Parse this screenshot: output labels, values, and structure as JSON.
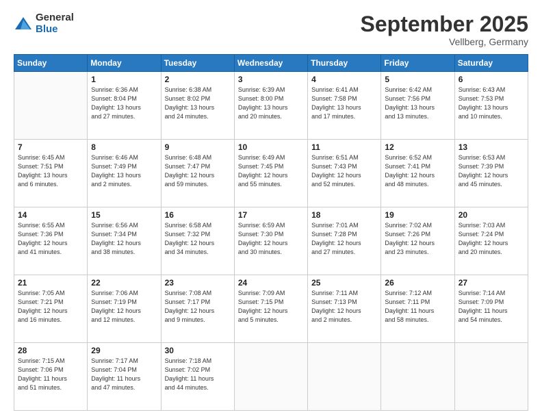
{
  "logo": {
    "general": "General",
    "blue": "Blue"
  },
  "title": "September 2025",
  "location": "Vellberg, Germany",
  "days_header": [
    "Sunday",
    "Monday",
    "Tuesday",
    "Wednesday",
    "Thursday",
    "Friday",
    "Saturday"
  ],
  "weeks": [
    [
      {
        "num": "",
        "info": ""
      },
      {
        "num": "1",
        "info": "Sunrise: 6:36 AM\nSunset: 8:04 PM\nDaylight: 13 hours\nand 27 minutes."
      },
      {
        "num": "2",
        "info": "Sunrise: 6:38 AM\nSunset: 8:02 PM\nDaylight: 13 hours\nand 24 minutes."
      },
      {
        "num": "3",
        "info": "Sunrise: 6:39 AM\nSunset: 8:00 PM\nDaylight: 13 hours\nand 20 minutes."
      },
      {
        "num": "4",
        "info": "Sunrise: 6:41 AM\nSunset: 7:58 PM\nDaylight: 13 hours\nand 17 minutes."
      },
      {
        "num": "5",
        "info": "Sunrise: 6:42 AM\nSunset: 7:56 PM\nDaylight: 13 hours\nand 13 minutes."
      },
      {
        "num": "6",
        "info": "Sunrise: 6:43 AM\nSunset: 7:53 PM\nDaylight: 13 hours\nand 10 minutes."
      }
    ],
    [
      {
        "num": "7",
        "info": "Sunrise: 6:45 AM\nSunset: 7:51 PM\nDaylight: 13 hours\nand 6 minutes."
      },
      {
        "num": "8",
        "info": "Sunrise: 6:46 AM\nSunset: 7:49 PM\nDaylight: 13 hours\nand 2 minutes."
      },
      {
        "num": "9",
        "info": "Sunrise: 6:48 AM\nSunset: 7:47 PM\nDaylight: 12 hours\nand 59 minutes."
      },
      {
        "num": "10",
        "info": "Sunrise: 6:49 AM\nSunset: 7:45 PM\nDaylight: 12 hours\nand 55 minutes."
      },
      {
        "num": "11",
        "info": "Sunrise: 6:51 AM\nSunset: 7:43 PM\nDaylight: 12 hours\nand 52 minutes."
      },
      {
        "num": "12",
        "info": "Sunrise: 6:52 AM\nSunset: 7:41 PM\nDaylight: 12 hours\nand 48 minutes."
      },
      {
        "num": "13",
        "info": "Sunrise: 6:53 AM\nSunset: 7:39 PM\nDaylight: 12 hours\nand 45 minutes."
      }
    ],
    [
      {
        "num": "14",
        "info": "Sunrise: 6:55 AM\nSunset: 7:36 PM\nDaylight: 12 hours\nand 41 minutes."
      },
      {
        "num": "15",
        "info": "Sunrise: 6:56 AM\nSunset: 7:34 PM\nDaylight: 12 hours\nand 38 minutes."
      },
      {
        "num": "16",
        "info": "Sunrise: 6:58 AM\nSunset: 7:32 PM\nDaylight: 12 hours\nand 34 minutes."
      },
      {
        "num": "17",
        "info": "Sunrise: 6:59 AM\nSunset: 7:30 PM\nDaylight: 12 hours\nand 30 minutes."
      },
      {
        "num": "18",
        "info": "Sunrise: 7:01 AM\nSunset: 7:28 PM\nDaylight: 12 hours\nand 27 minutes."
      },
      {
        "num": "19",
        "info": "Sunrise: 7:02 AM\nSunset: 7:26 PM\nDaylight: 12 hours\nand 23 minutes."
      },
      {
        "num": "20",
        "info": "Sunrise: 7:03 AM\nSunset: 7:24 PM\nDaylight: 12 hours\nand 20 minutes."
      }
    ],
    [
      {
        "num": "21",
        "info": "Sunrise: 7:05 AM\nSunset: 7:21 PM\nDaylight: 12 hours\nand 16 minutes."
      },
      {
        "num": "22",
        "info": "Sunrise: 7:06 AM\nSunset: 7:19 PM\nDaylight: 12 hours\nand 12 minutes."
      },
      {
        "num": "23",
        "info": "Sunrise: 7:08 AM\nSunset: 7:17 PM\nDaylight: 12 hours\nand 9 minutes."
      },
      {
        "num": "24",
        "info": "Sunrise: 7:09 AM\nSunset: 7:15 PM\nDaylight: 12 hours\nand 5 minutes."
      },
      {
        "num": "25",
        "info": "Sunrise: 7:11 AM\nSunset: 7:13 PM\nDaylight: 12 hours\nand 2 minutes."
      },
      {
        "num": "26",
        "info": "Sunrise: 7:12 AM\nSunset: 7:11 PM\nDaylight: 11 hours\nand 58 minutes."
      },
      {
        "num": "27",
        "info": "Sunrise: 7:14 AM\nSunset: 7:09 PM\nDaylight: 11 hours\nand 54 minutes."
      }
    ],
    [
      {
        "num": "28",
        "info": "Sunrise: 7:15 AM\nSunset: 7:06 PM\nDaylight: 11 hours\nand 51 minutes."
      },
      {
        "num": "29",
        "info": "Sunrise: 7:17 AM\nSunset: 7:04 PM\nDaylight: 11 hours\nand 47 minutes."
      },
      {
        "num": "30",
        "info": "Sunrise: 7:18 AM\nSunset: 7:02 PM\nDaylight: 11 hours\nand 44 minutes."
      },
      {
        "num": "",
        "info": ""
      },
      {
        "num": "",
        "info": ""
      },
      {
        "num": "",
        "info": ""
      },
      {
        "num": "",
        "info": ""
      }
    ]
  ]
}
